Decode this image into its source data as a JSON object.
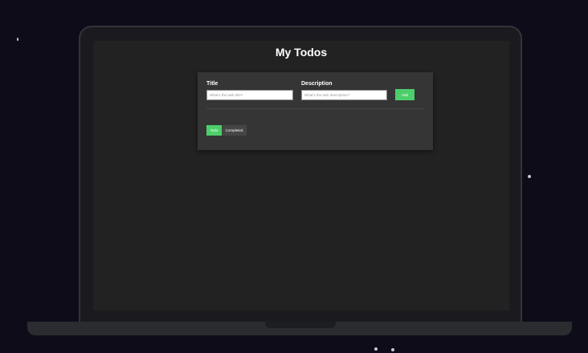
{
  "app": {
    "title": "My Todos"
  },
  "form": {
    "title_label": "Title",
    "title_placeholder": "What's the task title?",
    "title_value": "",
    "description_label": "Description",
    "description_placeholder": "What's the task description?",
    "description_value": "",
    "add_label": "Add"
  },
  "tabs": [
    {
      "label": "Todo",
      "active": true
    },
    {
      "label": "Completed",
      "active": false
    }
  ],
  "colors": {
    "accent": "#4ccf6b",
    "screen_bg": "#222222",
    "card_bg": "#353535",
    "page_bg": "#0f0c1a"
  }
}
